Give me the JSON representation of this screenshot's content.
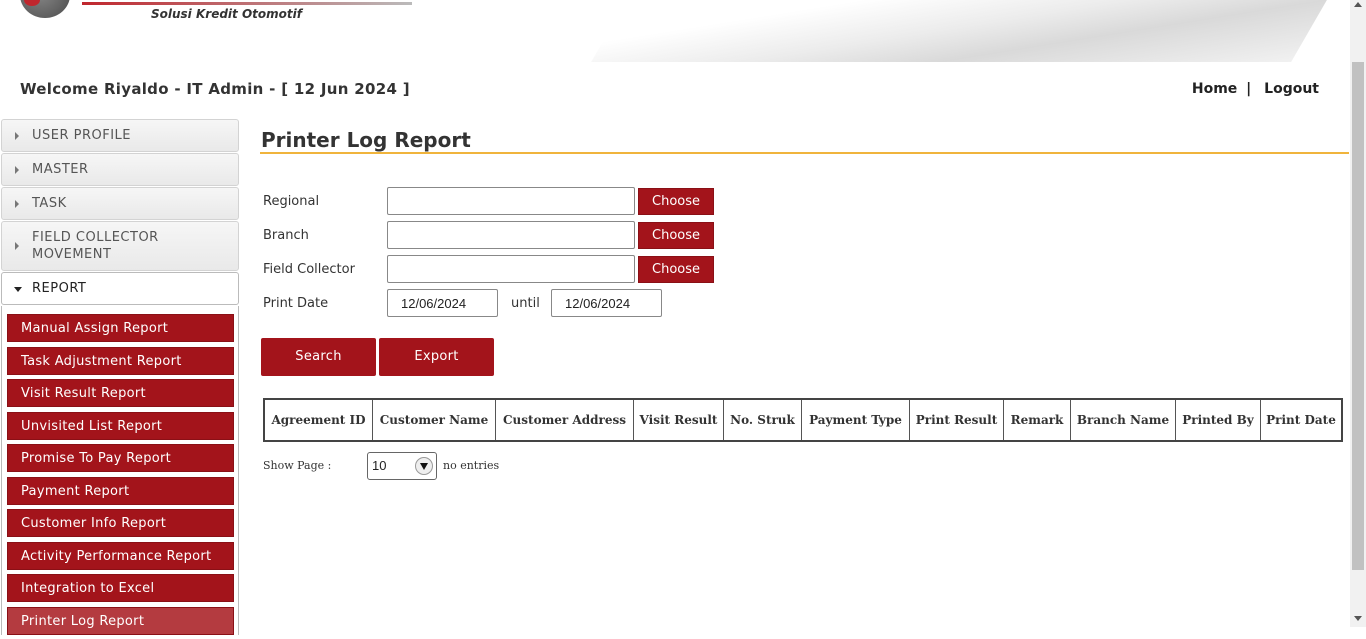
{
  "header": {
    "tagline": "Solusi Kredit Otomotif"
  },
  "welcome": {
    "text": "Welcome Riyaldo - IT Admin - [ 12 Jun 2024 ]"
  },
  "topnav": {
    "home": "Home",
    "separator": "|",
    "logout": "Logout"
  },
  "sidebar": {
    "sections": [
      {
        "label": "USER PROFILE",
        "expanded": false
      },
      {
        "label": "MASTER",
        "expanded": false
      },
      {
        "label": "TASK",
        "expanded": false
      },
      {
        "label": "FIELD COLLECTOR MOVEMENT",
        "expanded": false
      },
      {
        "label": "REPORT",
        "expanded": true
      }
    ],
    "report_items": [
      {
        "label": "Manual Assign Report"
      },
      {
        "label": "Task Adjustment Report"
      },
      {
        "label": "Visit Result Report"
      },
      {
        "label": "Unvisited List Report"
      },
      {
        "label": "Promise To Pay Report"
      },
      {
        "label": "Payment Report"
      },
      {
        "label": "Customer Info Report"
      },
      {
        "label": "Activity Performance Report"
      },
      {
        "label": "Integration to Excel"
      },
      {
        "label": "Printer Log Report"
      }
    ],
    "active_item": "Printer Log Report"
  },
  "main": {
    "title": "Printer Log Report",
    "form": {
      "regional_label": "Regional",
      "regional_value": "",
      "branch_label": "Branch",
      "branch_value": "",
      "field_collector_label": "Field Collector",
      "field_collector_value": "",
      "choose_label": "Choose",
      "print_date_label": "Print Date",
      "date_from": "12/06/2024",
      "until_label": "until",
      "date_to": "12/06/2024"
    },
    "buttons": {
      "search": "Search",
      "export": "Export"
    },
    "table": {
      "columns": [
        "Agreement ID",
        "Customer Name",
        "Customer Address",
        "Visit Result",
        "No. Struk",
        "Payment Type",
        "Print Result",
        "Remark",
        "Branch Name",
        "Printed By",
        "Print Date"
      ],
      "rows": []
    },
    "paging": {
      "show_page_label": "Show Page :",
      "page_size": "10",
      "entries_text": "no entries"
    }
  },
  "colors": {
    "accent_red": "#a3141b",
    "active_item": "#b43b40",
    "title_rule": "#f0b43c"
  }
}
